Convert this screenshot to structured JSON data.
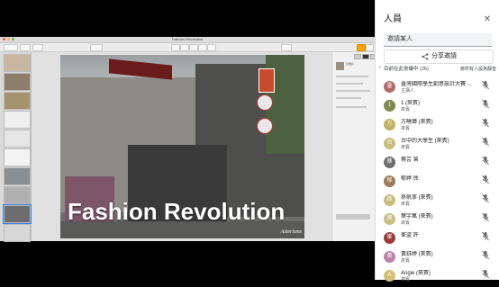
{
  "presentation": {
    "window_title": "Fashion Revolution",
    "slide": {
      "headline": "Fashion Revolution",
      "watermark": "Asterisms"
    },
    "inspector": {
      "label": "幻燈片"
    }
  },
  "people_panel": {
    "title": "人員",
    "close_icon": "close-icon",
    "invite_placeholder": "邀請某人",
    "share_invite_label": "分享邀請",
    "section_label": "目前在此會議中 (26)",
    "mute_all_label": "將所有人設為靜音",
    "participants": [
      {
        "name": "臺灣國際學生創意設計大賽 ...",
        "role": "主講人",
        "initial": "臺",
        "color": "#b06a66"
      },
      {
        "name": "1 (來賓)",
        "role": "來賓",
        "initial": "1",
        "color": "#7c8a4e"
      },
      {
        "name": "方曉瑋 (來賓)",
        "role": "來賓",
        "initial": "方",
        "color": "#c4b063"
      },
      {
        "name": "台中的大學生 (來賓)",
        "role": "來賓",
        "initial": "台",
        "color": "#c8bf7a"
      },
      {
        "name": "蔡芸 曾",
        "role": "",
        "initial": "蔡",
        "color": "#6e6e6e"
      },
      {
        "name": "郁婷 徐",
        "role": "",
        "initial": "郁",
        "color": "#9c7c56"
      },
      {
        "name": "孫帆寧 (來賓)",
        "role": "來賓",
        "initial": "孫",
        "color": "#c8bd7e"
      },
      {
        "name": "葉宇萬 (來賓)",
        "role": "來賓",
        "initial": "葉",
        "color": "#c9bf82"
      },
      {
        "name": "峯盜 許",
        "role": "",
        "initial": "峯",
        "color": "#9a3d3a"
      },
      {
        "name": "黃鈺婷 (來賓)",
        "role": "來賓",
        "initial": "黃",
        "color": "#b883a6"
      },
      {
        "name": "Angie (來賓)",
        "role": "來賓",
        "initial": "A",
        "color": "#d3c177"
      }
    ]
  }
}
